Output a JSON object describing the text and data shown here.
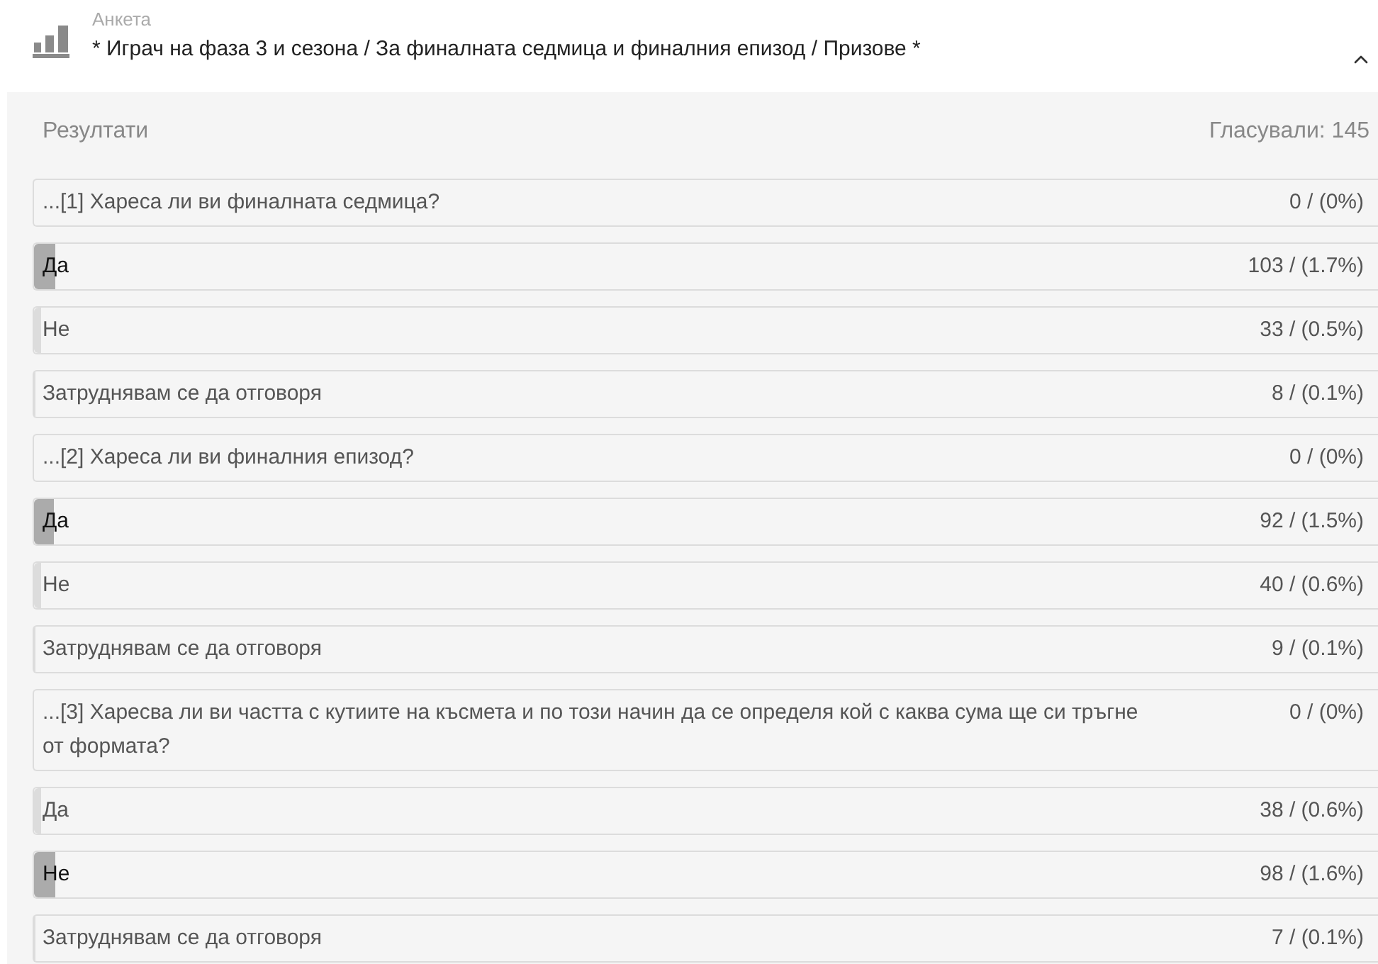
{
  "poll": {
    "label": "Анкета",
    "title": "* Играч на фаза 3 и сезона / За финалната седмица и финалния епизод / Призове *",
    "expanded": true
  },
  "results": {
    "heading": "Резултати",
    "votes": "Гласували: 145"
  },
  "rows": [
    {
      "kind": "question",
      "text": "...[1] Хареса ли ви финалната седмица?",
      "count": "0 / (0%)"
    },
    {
      "kind": "answer",
      "text": "Да",
      "count": "103 / (1.7%)",
      "level": 0.016,
      "leading": true
    },
    {
      "kind": "answer",
      "text": "Не",
      "count": "33 / (0.5%)",
      "level": 0.005,
      "leading": false
    },
    {
      "kind": "answer",
      "text": "Затруднявам се да отговоря",
      "count": "8 / (0.1%)",
      "level": 0.001,
      "leading": false
    },
    {
      "kind": "question",
      "text": "...[2] Хареса ли ви финалния епизод?",
      "count": "0 / (0%)"
    },
    {
      "kind": "answer",
      "text": "Да",
      "count": "92 / (1.5%)",
      "level": 0.015,
      "leading": true
    },
    {
      "kind": "answer",
      "text": "Не",
      "count": "40 / (0.6%)",
      "level": 0.005,
      "leading": false
    },
    {
      "kind": "answer",
      "text": "Затруднявам се да отговоря",
      "count": "9 / (0.1%)",
      "level": 0.001,
      "leading": false
    },
    {
      "kind": "question",
      "text": "...[3] Харесва ли ви частта с кутиите на късмета и по този начин да се определя кой с каква сума ще си тръгне от формата?",
      "count": "0 / (0%)"
    },
    {
      "kind": "answer",
      "text": "Да",
      "count": "38 / (0.6%)",
      "level": 0.005,
      "leading": false
    },
    {
      "kind": "answer",
      "text": "Не",
      "count": "98 / (1.6%)",
      "level": 0.016,
      "leading": true
    },
    {
      "kind": "answer",
      "text": "Затруднявам се да отговоря",
      "count": "7 / (0.1%)",
      "level": 0.001,
      "leading": false
    }
  ]
}
